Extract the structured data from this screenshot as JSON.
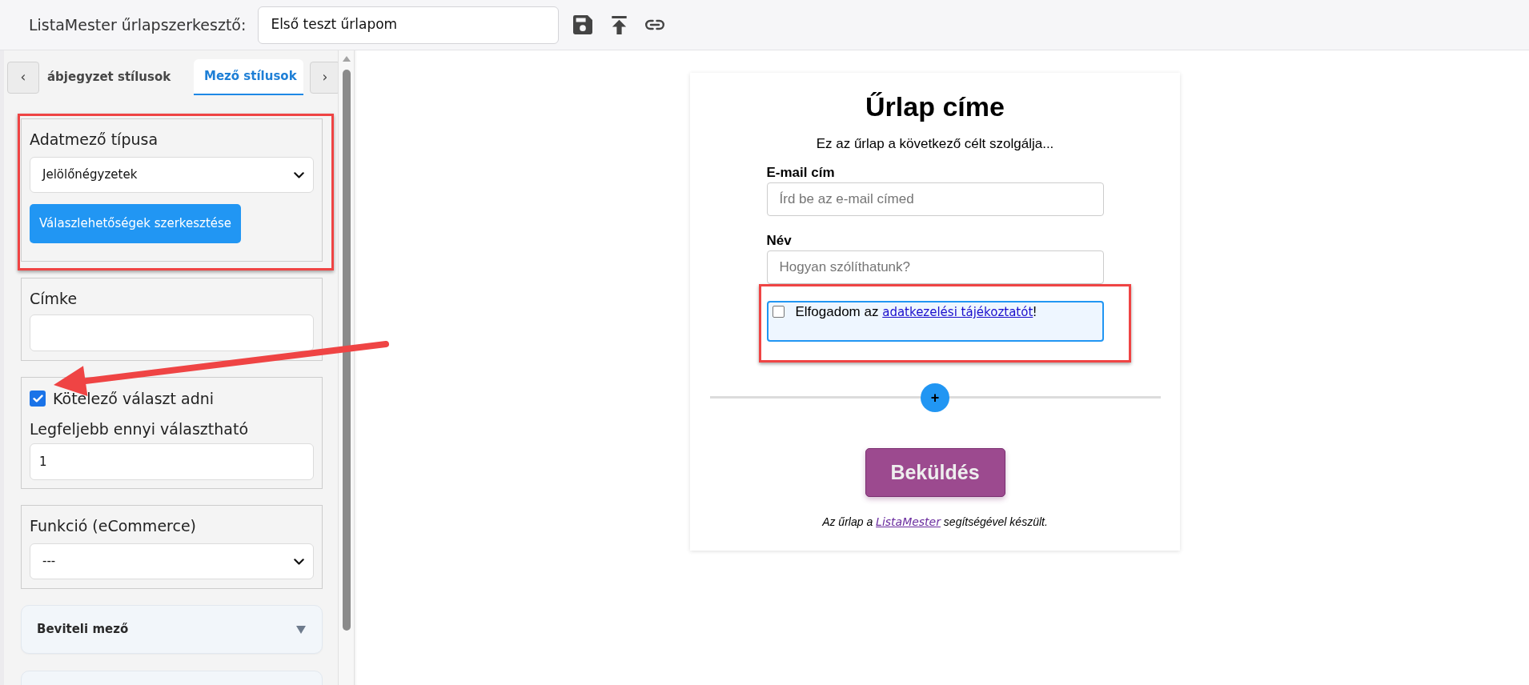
{
  "header": {
    "title": "ListaMester űrlapszerkesztő:",
    "form_name": "Első teszt űrlapom"
  },
  "sidebar": {
    "prev_button": "‹",
    "tabs": [
      {
        "label": "ábjegyzet stílusok",
        "selected": false
      },
      {
        "label": "Mező stílusok",
        "selected": true
      }
    ],
    "next_button": "›",
    "sections": [
      {
        "kind": "select",
        "label": "Adatmező típusa",
        "value": "Jelölőnégyzetek",
        "button": "Válaszlehetőségek szerkesztése",
        "highlighted": true
      },
      {
        "kind": "text",
        "label": "Címke",
        "highlighted": false
      },
      {
        "kind": "checkbox-number",
        "checkbox": {
          "label": "Kötelező választ adni",
          "checked": true
        },
        "label": "Legfeljebb ennyi választható",
        "value": "1",
        "highlighted": false
      },
      {
        "kind": "select",
        "label": "Funkció (eCommerce)",
        "value": "---",
        "highlighted": false
      }
    ],
    "accordions": [
      {
        "kind": "accordion",
        "label": "Beviteli mező",
        "expanded": false
      },
      {
        "kind": "cut"
      }
    ]
  },
  "form": {
    "title": "Űrlap címe",
    "description": "Ez az űrlap a következő célt szolgálja...",
    "fields": [
      {
        "kind": "input",
        "label": "E-mail cím",
        "placeholder": "Írd be az e-mail címed",
        "highlighted": false
      },
      {
        "kind": "input",
        "label": "Név",
        "placeholder": "Hogyan szólíthatunk?",
        "highlighted": false
      },
      {
        "kind": "consent",
        "checked": false,
        "text": "Elfogadom az ",
        "link": "adatkezelési tájékoztatót",
        "text_after": "!",
        "highlighted": true
      }
    ],
    "add_button": "+",
    "submit": "Beküldés",
    "credit": {
      "text": "Az űrlap a ",
      "link": "ListaMester",
      "text_after": " segítségével készült."
    }
  },
  "annotations": [
    {
      "kind": "arrow"
    }
  ]
}
